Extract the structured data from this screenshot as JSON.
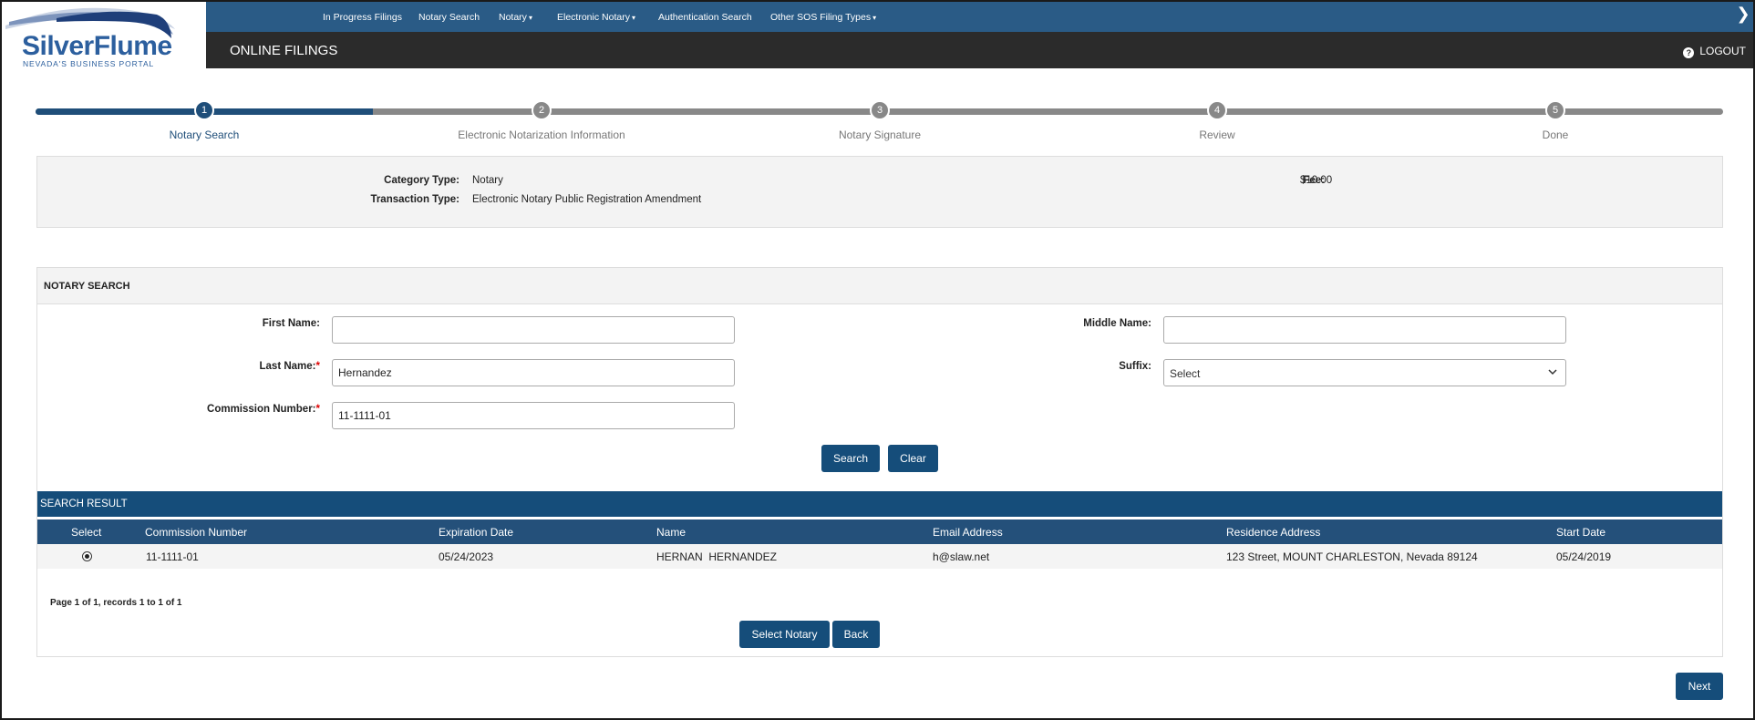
{
  "brand": {
    "name": "SilverFlume",
    "tagline": "NEVADA'S BUSINESS PORTAL"
  },
  "topnav": {
    "items": [
      {
        "label": "In Progress Filings",
        "dropdown": false
      },
      {
        "label": "Notary Search",
        "dropdown": false
      },
      {
        "label": "Notary",
        "dropdown": true
      },
      {
        "label": "Electronic Notary",
        "dropdown": true
      },
      {
        "label": "Authentication Search",
        "dropdown": false
      },
      {
        "label": "Other SOS Filing Types",
        "dropdown": true
      }
    ],
    "caret": "▾",
    "expand_glyph": "❯"
  },
  "titlebar": {
    "title": "ONLINE FILINGS",
    "logout_label": "LOGOUT",
    "logout_icon": "?"
  },
  "stepper": {
    "current": 1,
    "steps": [
      {
        "num": "1",
        "label": "Notary Search"
      },
      {
        "num": "2",
        "label": "Electronic Notarization Information"
      },
      {
        "num": "3",
        "label": "Notary Signature"
      },
      {
        "num": "4",
        "label": "Review"
      },
      {
        "num": "5",
        "label": "Done"
      }
    ]
  },
  "filing_info": {
    "category_label": "Category Type:",
    "category_value": "Notary",
    "transaction_label": "Transaction Type:",
    "transaction_value": "Electronic Notary Public Registration Amendment",
    "fee_label": "Fee:",
    "fee_value": "$10.00"
  },
  "search": {
    "panel_title": "NOTARY SEARCH",
    "first_name_label": "First Name:",
    "first_name_value": "",
    "middle_name_label": "Middle Name:",
    "middle_name_value": "",
    "last_name_label": "Last Name:",
    "last_name_value": "Hernandez",
    "suffix_label": "Suffix:",
    "suffix_value": "Select",
    "commission_label": "Commission Number:",
    "commission_value": "11-1111-01",
    "required_mark": "*",
    "search_button": "Search",
    "clear_button": "Clear"
  },
  "results": {
    "title": "SEARCH RESULT",
    "columns": [
      "Select",
      "Commission Number",
      "Expiration Date",
      "Name",
      "Email Address",
      "Residence Address",
      "Start Date"
    ],
    "rows": [
      {
        "selected": true,
        "commission": "11-1111-01",
        "expiration": "05/24/2023",
        "name": "HERNAN  HERNANDEZ",
        "email": "h@slaw.net",
        "address": "123 Street, MOUNT CHARLESTON, Nevada 89124",
        "start": "05/24/2019"
      }
    ],
    "pager_text": "Page 1 of 1, records 1 to 1 of 1",
    "select_button": "Select Notary",
    "back_button": "Back"
  },
  "footer": {
    "next_button": "Next"
  }
}
